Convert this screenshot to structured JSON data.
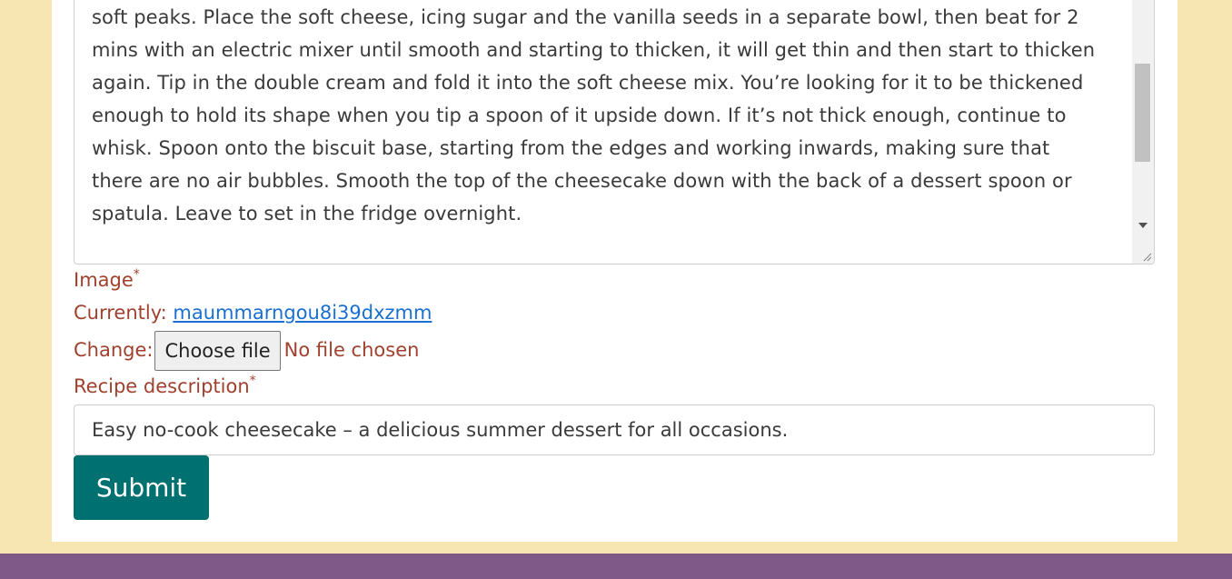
{
  "method": {
    "lines": [
      "soft peaks. Place the soft cheese, icing sugar and the vanilla seeds in a separate bowl, then beat for 2",
      "mins with an electric mixer until smooth and starting to thicken, it will get thin and then start to thicken",
      "again. Tip in the double cream and fold it into the soft cheese mix. You’re looking for it to be thickened",
      "enough to hold its shape when you tip a spoon of it upside down. If it’s not thick enough, continue to",
      "whisk. Spoon onto the biscuit base, starting from the edges and working inwards, making sure that",
      "there are no air bubbles. Smooth the top of the cheesecake down with the back of a dessert spoon or",
      "spatula. Leave to set in the fridge overnight."
    ]
  },
  "image_field": {
    "label": "Image",
    "required_mark": "*",
    "currently_label": "Currently:",
    "currently_value": "maummarngou8i39dxzmm",
    "change_label": "Change:",
    "choose_button": "Choose file",
    "no_file": "No file chosen"
  },
  "description_field": {
    "label": "Recipe description",
    "required_mark": "*",
    "value": "Easy no-cook cheesecake – a delicious summer dessert for all occasions."
  },
  "submit": {
    "label": "Submit"
  },
  "colors": {
    "background": "#f7e6b1",
    "label": "#a0412d",
    "link": "#1a6fd1",
    "submit": "#007070",
    "footer": "#7f5a88"
  }
}
